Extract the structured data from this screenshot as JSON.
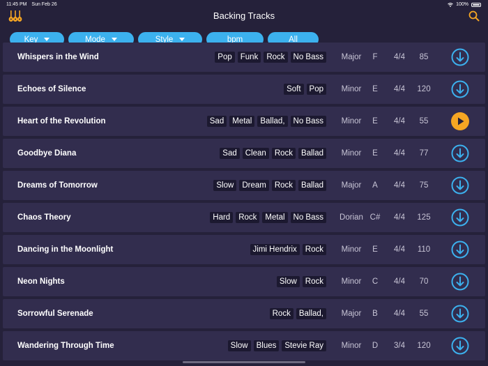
{
  "status": {
    "time": "11:45 PM",
    "date": "Sun Feb 26",
    "battery": "100%"
  },
  "header": {
    "title": "Backing Tracks"
  },
  "filters": [
    {
      "label": "Key",
      "dropdown": true
    },
    {
      "label": "Mode",
      "dropdown": true
    },
    {
      "label": "Style",
      "dropdown": true
    },
    {
      "label": "bpm",
      "dropdown": false
    },
    {
      "label": "All",
      "dropdown": false
    }
  ],
  "colors": {
    "accent": "#3cb1ee",
    "playing": "#f6a623",
    "background": "#25213a",
    "row": "#322d4e",
    "tag": "#1c1930"
  },
  "tracks": [
    {
      "title": "Whispers in the Wind",
      "tags": [
        "Pop",
        "Funk",
        "Rock",
        "No Bass"
      ],
      "mode": "Major",
      "key": "F",
      "time": "4/4",
      "bpm": "85",
      "action": "download-icon"
    },
    {
      "title": "Echoes of Silence",
      "tags": [
        "Soft",
        "Pop"
      ],
      "mode": "Minor",
      "key": "E",
      "time": "4/4",
      "bpm": "120",
      "action": "download-icon"
    },
    {
      "title": "Heart of the Revolution",
      "tags": [
        "Sad",
        "Metal",
        "Ballad,",
        "No Bass"
      ],
      "mode": "Minor",
      "key": "E",
      "time": "4/4",
      "bpm": "55",
      "action": "play-icon"
    },
    {
      "title": "Goodbye Diana",
      "tags": [
        "Sad",
        "Clean",
        "Rock",
        "Ballad"
      ],
      "mode": "Minor",
      "key": "E",
      "time": "4/4",
      "bpm": "77",
      "action": "download-icon"
    },
    {
      "title": "Dreams of Tomorrow",
      "tags": [
        "Slow",
        "Dream",
        "Rock",
        "Ballad"
      ],
      "mode": "Major",
      "key": "A",
      "time": "4/4",
      "bpm": "75",
      "action": "download-icon"
    },
    {
      "title": "Chaos Theory",
      "tags": [
        "Hard",
        "Rock",
        "Metal",
        "No Bass"
      ],
      "mode": "Dorian",
      "key": "C#",
      "time": "4/4",
      "bpm": "125",
      "action": "download-icon"
    },
    {
      "title": "Dancing in the Moonlight",
      "tags": [
        "Jimi Hendrix",
        "Rock"
      ],
      "mode": "Minor",
      "key": "E",
      "time": "4/4",
      "bpm": "110",
      "action": "download-icon"
    },
    {
      "title": "Neon Nights",
      "tags": [
        "Slow",
        "Rock"
      ],
      "mode": "Minor",
      "key": "C",
      "time": "4/4",
      "bpm": "70",
      "action": "download-icon"
    },
    {
      "title": "Sorrowful Serenade",
      "tags": [
        "Rock",
        "Ballad,"
      ],
      "mode": "Major",
      "key": "B",
      "time": "4/4",
      "bpm": "55",
      "action": "download-icon"
    },
    {
      "title": "Wandering Through Time",
      "tags": [
        "Slow",
        "Blues",
        "Stevie Ray"
      ],
      "mode": "Minor",
      "key": "D",
      "time": "3/4",
      "bpm": "120",
      "action": "download-icon"
    }
  ]
}
